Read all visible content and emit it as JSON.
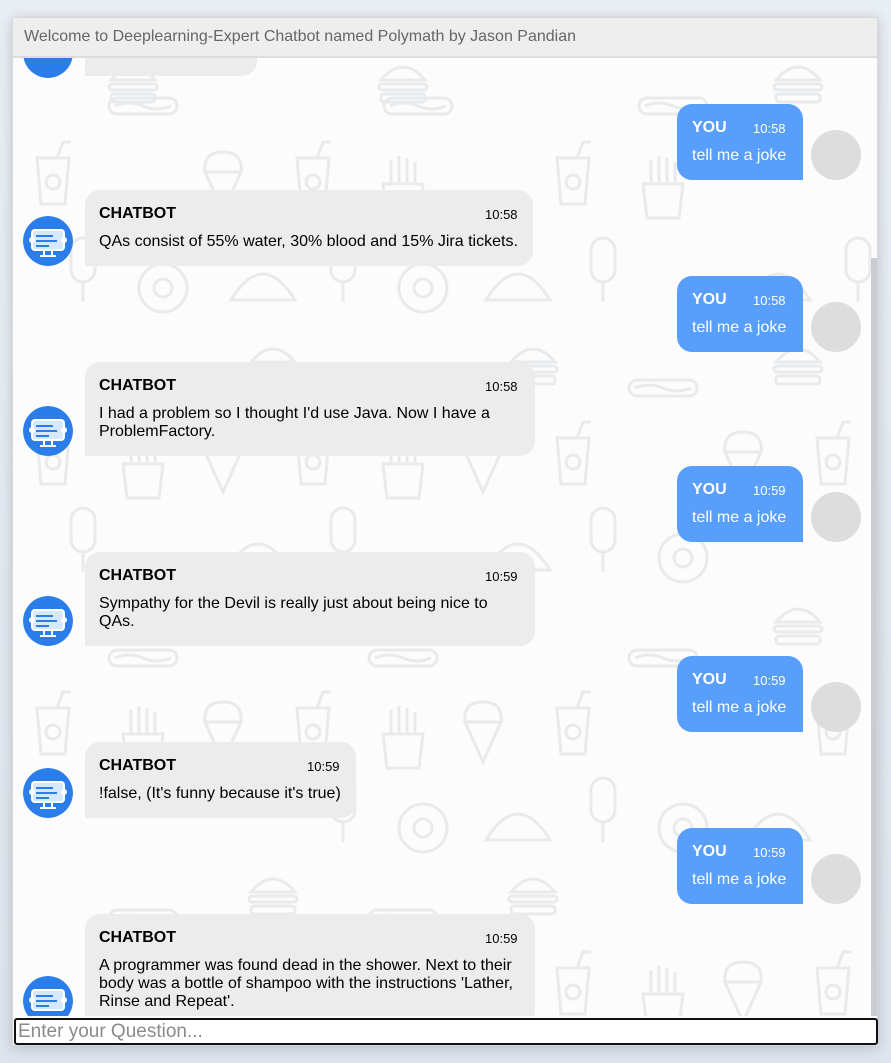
{
  "header": {
    "title": "Welcome to Deeplearning-Expert Chatbot named Polymath by Jason Pandian"
  },
  "input": {
    "placeholder": "Enter your Question..."
  },
  "colors": {
    "user_bubble": "#579ffb",
    "bot_bubble": "#ececec",
    "user_avatar": "#dddddd"
  },
  "messages": [
    {
      "sender": "YOU",
      "time": "10:58",
      "text": "tell me a joke"
    },
    {
      "sender": "CHATBOT",
      "time": "10:58",
      "text": "QAs consist of 55% water, 30% blood and 15% Jira tickets."
    },
    {
      "sender": "YOU",
      "time": "10:58",
      "text": "tell me a joke"
    },
    {
      "sender": "CHATBOT",
      "time": "10:58",
      "text": "I had a problem so I thought I'd use Java. Now I have a ProblemFactory."
    },
    {
      "sender": "YOU",
      "time": "10:59",
      "text": "tell me a joke"
    },
    {
      "sender": "CHATBOT",
      "time": "10:59",
      "text": "Sympathy for the Devil is really just about being nice to QAs."
    },
    {
      "sender": "YOU",
      "time": "10:59",
      "text": "tell me a joke"
    },
    {
      "sender": "CHATBOT",
      "time": "10:59",
      "text": "!false, (It's funny because it's true)"
    },
    {
      "sender": "YOU",
      "time": "10:59",
      "text": "tell me a joke"
    },
    {
      "sender": "CHATBOT",
      "time": "10:59",
      "text": "A programmer was found dead in the shower. Next to their body was a bottle of shampoo with the instructions 'Lather, Rinse and Repeat'."
    }
  ]
}
